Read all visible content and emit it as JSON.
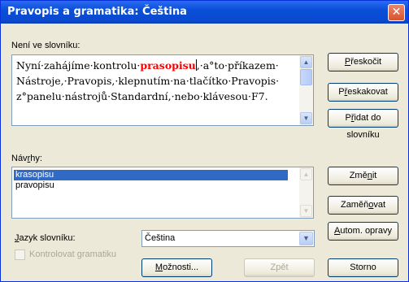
{
  "window": {
    "title": "Pravopis a gramatika: Čeština",
    "close_glyph": "✕"
  },
  "not_in_dictionary": {
    "label": "Není ve slovníku:",
    "text_before": "Nyní·zahájíme·kontrolu·",
    "error_word": "prasopisu",
    "text_after_line1": ",·a°to·příkazem·",
    "line2": "Nástroje,·Pravopis,·klepnutím·na·tlačítko·Pravopis·",
    "line3": "z°panelu·nástrojů·Standardní,·nebo·klávesou·F7."
  },
  "suggestions": {
    "label": "Návrhy:",
    "items": [
      "krasopisu",
      "pravopisu"
    ],
    "selected_index": 0
  },
  "buttons": {
    "ignore": "Přeskočit",
    "ignore_all": "Přeskakovat",
    "add": "Přidat do slovníku",
    "change": "Zaměnit",
    "change_all": "Zaměňovat",
    "autocorrect": "Autom. opravy",
    "options": "Možnosti...",
    "undo": "Zpět",
    "cancel": "Storno"
  },
  "dictionary_language": {
    "label": "Jazyk slovníku:",
    "value": "Čeština"
  },
  "check_grammar": {
    "label": "Kontrolovat gramatiku",
    "checked": false,
    "enabled": false
  },
  "icons": {
    "scroll_up": "▲",
    "scroll_down": "▼",
    "dropdown": "▼"
  },
  "colors": {
    "title_bar": "#0a4fd8",
    "error_text": "#ff0000",
    "selection": "#316ac5"
  }
}
